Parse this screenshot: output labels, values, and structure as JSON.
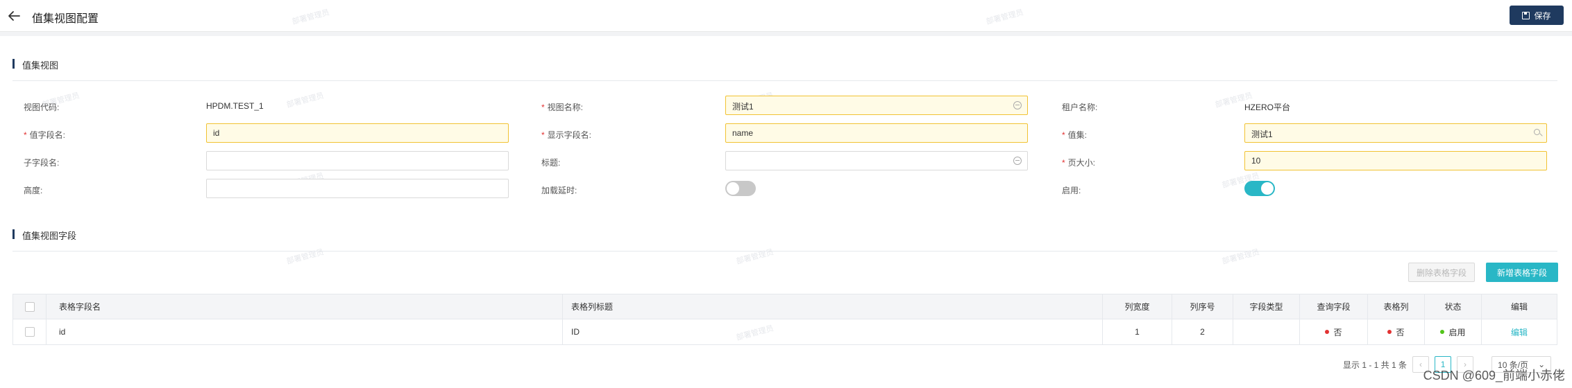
{
  "header": {
    "title": "值集视图配置",
    "save_label": "保存"
  },
  "section1": {
    "title": "值集视图"
  },
  "form": {
    "view_code_label": "视图代码:",
    "view_code_value": "HPDM.TEST_1",
    "view_name_label": "视图名称:",
    "view_name_value": "测试1",
    "tenant_label": "租户名称:",
    "tenant_value": "HZERO平台",
    "value_field_label": "值字段名:",
    "value_field_value": "id",
    "display_field_label": "显示字段名:",
    "display_field_value": "name",
    "value_set_label": "值集:",
    "value_set_value": "测试1",
    "child_field_label": "子字段名:",
    "child_field_value": "",
    "title_label": "标题:",
    "title_value": "",
    "page_size_label": "页大小:",
    "page_size_value": "10",
    "height_label": "高度:",
    "height_value": "",
    "lazy_label": "加载延时:",
    "lazy_on": false,
    "enabled_label": "启用:",
    "enabled_on": true
  },
  "section2": {
    "title": "值集视图字段"
  },
  "buttons": {
    "delete_label": "删除表格字段",
    "add_label": "新增表格字段"
  },
  "table": {
    "headers": [
      "表格字段名",
      "表格列标题",
      "列宽度",
      "列序号",
      "字段类型",
      "查询字段",
      "表格列",
      "状态",
      "编辑"
    ],
    "rows": [
      {
        "field": "id",
        "title": "ID",
        "width": "1",
        "order": "2",
        "type": "",
        "query": "否",
        "column": "否",
        "status": "启用",
        "edit": "编辑"
      }
    ]
  },
  "pagination": {
    "summary": "显示 1 - 1 共 1 条",
    "page": "1",
    "prev": "‹",
    "next": "›",
    "page_size": "10 条/页",
    "size_arrow": "⌄"
  },
  "colors": {
    "primary": "#29b7c6",
    "dark": "#1f3a5f",
    "required": "#e23232",
    "status_red": "#e23232",
    "status_green": "#52c41a"
  },
  "watermark": "部署管理员",
  "csdn": "CSDN @609_前端小赤佬"
}
